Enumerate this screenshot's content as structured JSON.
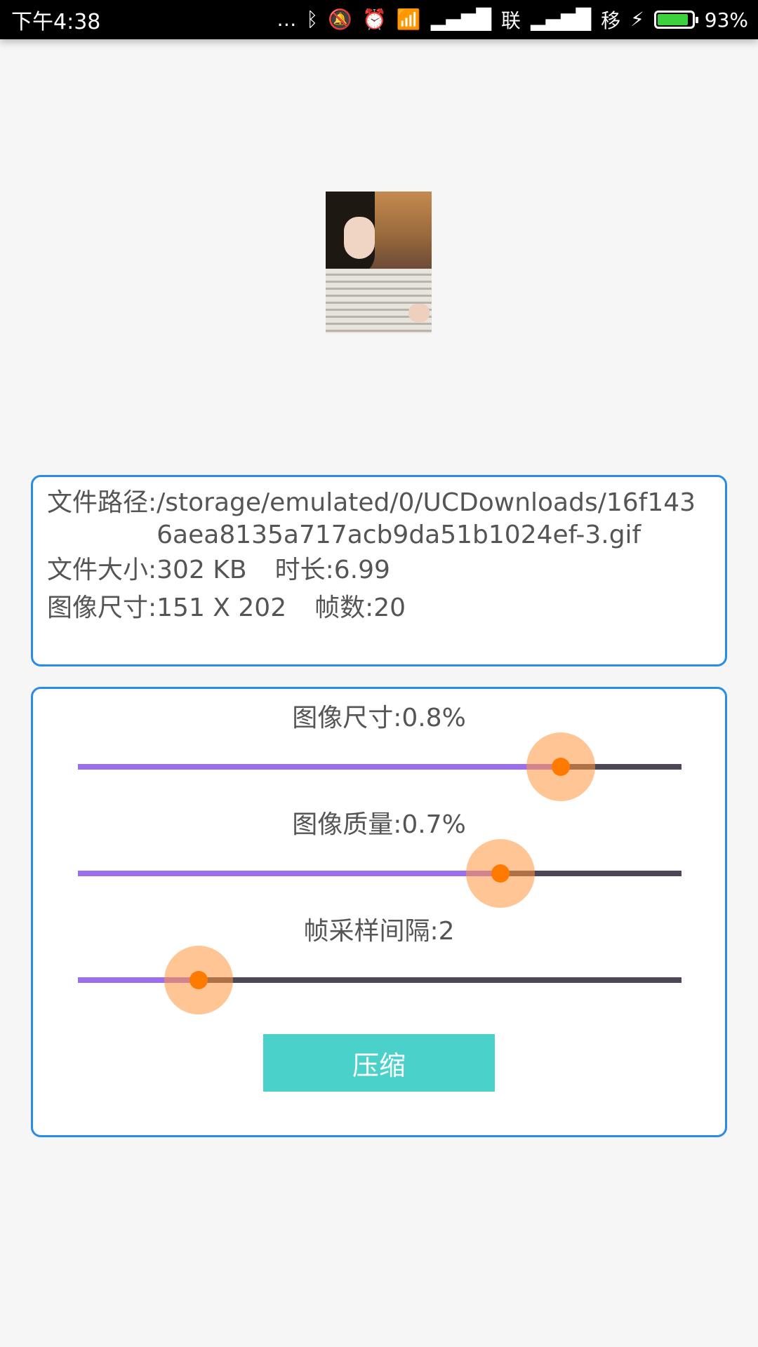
{
  "status_bar": {
    "time": "下午4:38",
    "carrier1": "联",
    "carrier2": "移",
    "battery": "93%",
    "battery_level": 0.93,
    "icons": [
      "more-icon",
      "bluetooth-icon",
      "mute-icon",
      "alarm-icon",
      "wifi-icon",
      "signal-icon",
      "signal-icon",
      "charging-icon",
      "battery-icon"
    ]
  },
  "info": {
    "path_label": "文件路径:",
    "path_value": "/storage/emulated/0/UCDownloads/16f1436aea8135a717acb9da51b1024ef-3.gif",
    "size_label": "文件大小:",
    "size_value": "302 KB",
    "duration_label": "时长:",
    "duration_value": "6.99",
    "dim_label": "图像尺寸:",
    "dim_value": "151 X 202",
    "frames_label": "帧数:",
    "frames_value": "20"
  },
  "sliders": [
    {
      "title": "图像尺寸:0.8%",
      "value": 0.8
    },
    {
      "title": "图像质量:0.7%",
      "value": 0.7
    },
    {
      "title": "帧采样间隔:2",
      "value": 0.2
    }
  ],
  "compress_label": "压缩",
  "colors": {
    "accent": "#2a8ce6",
    "slider_fill": "#9b6ef0",
    "slider_track": "#4e4656",
    "knob": "#ff7a00",
    "button": "#4ad1c9"
  }
}
